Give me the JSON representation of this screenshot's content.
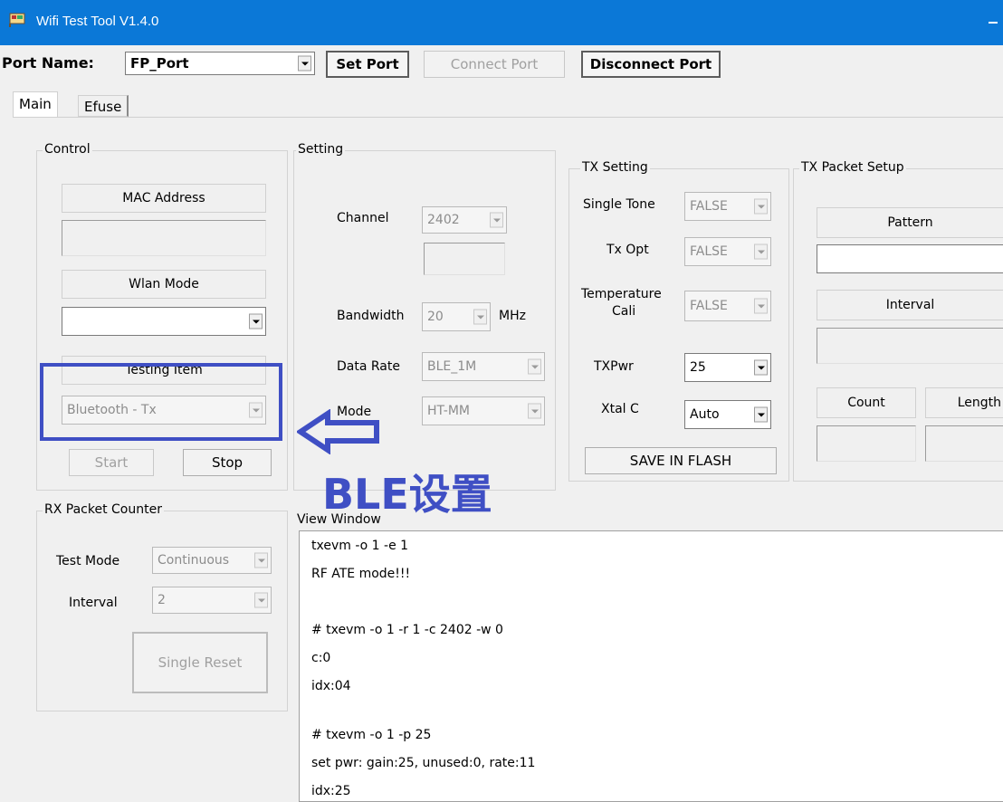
{
  "window": {
    "title": "Wifi Test Tool V1.4.0"
  },
  "port": {
    "label": "Port Name:",
    "value": "FP_Port",
    "set_port": "Set Port",
    "connect_port": "Connect Port",
    "disconnect_port": "Disconnect Port"
  },
  "tabs": [
    {
      "label": "Main"
    },
    {
      "label": "Efuse"
    }
  ],
  "control": {
    "title": "Control",
    "mac_label": "MAC Address",
    "wlan_label": "Wlan Mode",
    "testing_label": "Testing Item",
    "testing_value": "Bluetooth - Tx",
    "start": "Start",
    "stop": "Stop"
  },
  "setting": {
    "title": "Setting",
    "channel_label": "Channel",
    "channel_value": "2402",
    "bandwidth_label": "Bandwidth",
    "bandwidth_value": "20",
    "bandwidth_unit": "MHz",
    "datarate_label": "Data Rate",
    "datarate_value": "BLE_1M",
    "mode_label": "Mode",
    "mode_value": "HT-MM"
  },
  "tx_setting": {
    "title": "TX Setting",
    "single_tone_label": "Single Tone",
    "single_tone_value": "FALSE",
    "tx_opt_label": "Tx Opt",
    "tx_opt_value": "FALSE",
    "temp_label_1": "Temperature",
    "temp_label_2": "Cali",
    "temp_value": "FALSE",
    "txpwr_label": "TXPwr",
    "txpwr_value": "25",
    "xtal_label": "Xtal C",
    "xtal_value": "Auto",
    "save_flash": "SAVE IN FLASH"
  },
  "tx_packet": {
    "title": "TX Packet Setup",
    "pattern_label": "Pattern",
    "interval_label": "Interval",
    "count_label": "Count",
    "length_label": "Length"
  },
  "rx_counter": {
    "title": "RX Packet Counter",
    "test_mode_label": "Test Mode",
    "test_mode_value": "Continuous",
    "interval_label": "Interval",
    "interval_value": "2",
    "single_reset": "Single Reset"
  },
  "view_window": {
    "title": "View Window",
    "lines": [
      "txevm -o 1 -e 1",
      "RF ATE mode!!!",
      "",
      "# txevm -o 1 -r 1 -c 2402 -w 0",
      "c:0",
      "idx:04",
      "",
      "# txevm -o 1 -p 25",
      "set pwr: gain:25, unused:0, rate:11",
      "idx:25"
    ]
  },
  "annotation": {
    "text": "BLE设置",
    "color": "#3f4fc4"
  },
  "colors": {
    "titlebar": "#0b78d7",
    "annotation": "#3f4fc4"
  }
}
